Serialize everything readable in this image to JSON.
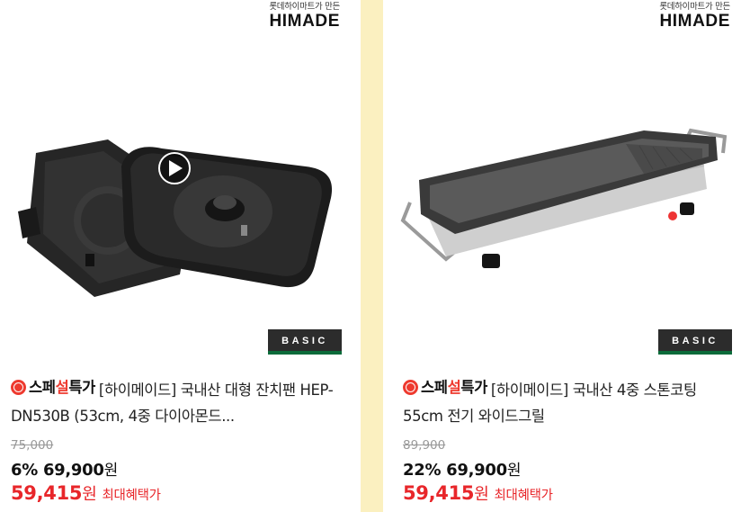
{
  "products": [
    {
      "brand_sub": "롯데하이마트가 만든",
      "brand_logo": "HIMADE",
      "badge": "BASIC",
      "special_prefix": "스페",
      "special_mid": "설",
      "special_suffix": "특가",
      "title": "[하이메이드] 국내산 대형 잔치팬 HEP-DN530B (53cm, 4중 다이아몬드...",
      "original_price": "75,000",
      "discount": "6%",
      "sale_price": "69,900",
      "won": "원",
      "benefit_price": "59,415",
      "benefit_label": "최대혜택가",
      "has_video": true
    },
    {
      "brand_sub": "롯데하이마트가 만든",
      "brand_logo": "HIMADE",
      "badge": "BASIC",
      "special_prefix": "스페",
      "special_mid": "설",
      "special_suffix": "특가",
      "title": "[하이메이드] 국내산 4중 스톤코팅 55cm 전기 와이드그릴",
      "original_price": "89,900",
      "discount": "22%",
      "sale_price": "69,900",
      "won": "원",
      "benefit_price": "59,415",
      "benefit_label": "최대혜택가",
      "has_video": false
    }
  ]
}
